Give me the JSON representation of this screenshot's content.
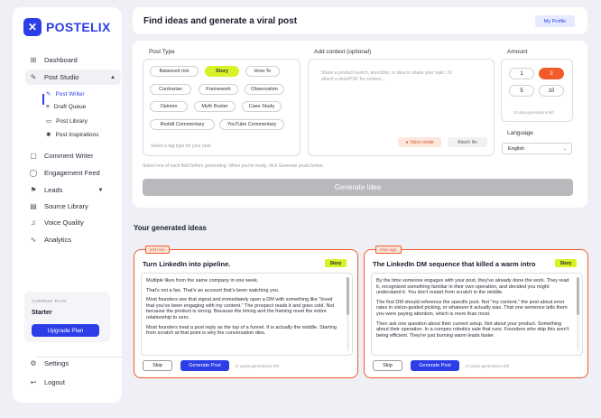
{
  "brand": {
    "name": "POSTELIX",
    "accent": "#2c3ee6",
    "highlight": "#d8f227",
    "orange": "#f15a29"
  },
  "sidebar": {
    "dashboard": "Dashboard",
    "post_studio": "Post Studio",
    "sub_items": [
      "Post Writer",
      "Draft Queue",
      "Post Library",
      "Post Inspirations"
    ],
    "comment_writer": "Comment Writer",
    "engagement_feed": "Engagement Feed",
    "leads": "Leads",
    "source_library": "Source Library",
    "voice_quality": "Voice Quality",
    "analytics": "Analytics",
    "plan_label": "CURRENT PLAN",
    "plan_name": "Starter",
    "upgrade": "Upgrade Plan",
    "settings": "Settings",
    "logout": "Logout"
  },
  "header": {
    "title": "Find ideas and generate a viral post",
    "profile": "My Profile"
  },
  "composer": {
    "post_type_title": "Post Type",
    "post_types": [
      "Balanced mix",
      "Story",
      "How-To",
      "Contrarian",
      "Framework",
      "Observation",
      "Opinion",
      "Myth Buster",
      "Case Study",
      "Reddit Commentary",
      "YouTube Commentary"
    ],
    "selected_type": "Story",
    "type_hint": "Select a tag type for your post.",
    "context_title": "Add context (optional)",
    "context_placeholder": "Share a product launch, anecdote, or idea to shape your topic. Or attach a deck/PDF for context...",
    "voice_mode": "Voice mode",
    "attach_file": "Attach file",
    "amount_title": "Amount",
    "amounts": [
      "1",
      "3",
      "5",
      "10"
    ],
    "selected_amount": "3",
    "amount_note": "14 idea generations left",
    "language_title": "Language",
    "language_value": "English",
    "fields_hint": "Select one of each field before generating. When you're ready, click Generate posts below.",
    "generate": "Generate Idea"
  },
  "ideas": {
    "title": "Your generated ideas",
    "cards": [
      {
        "time": "just now",
        "title": "Turn LinkedIn into pipeline.",
        "badge": "Story",
        "paragraphs": [
          "Multiple likes from the same company in one week.",
          "That's not a fan. That's an account that's been watching you.",
          "Most founders see that signal and immediately open a DM with something like \"loved that you've been engaging with my content.\" The prospect reads it and goes cold. Not because the product is wrong. Because the timing and the framing reset the entire relationship to zero.",
          "Most founders treat a post reply as the top of a funnel. It is actually the middle. Starting from scratch at that point is why the conversation dies."
        ],
        "skip": "Skip",
        "generate": "Generate Post",
        "left": "17 posts generations left"
      },
      {
        "time": "2min ago",
        "title": "The LinkedIn DM sequence that killed a warm intro",
        "badge": "Story",
        "paragraphs": [
          "By the time someone engages with your post, they've already done the work. They read it, recognized something familiar in their own operation, and decided you might understand it. You don't restart from scratch in the middle.",
          "The first DM should reference the specific post. Not \"my content,\" the post about error rates in vision-guided picking, or whatever it actually was. That one sentence tells them you were paying attention, which is more than most.",
          "Then ask one question about their current setup. Not about your product. Something about their operation. In a compex robotics sale that runs. Founders who skip this aren't being efficient. They're just burning warm leads faster."
        ],
        "skip": "Skip",
        "generate": "Generate Post",
        "left": "17 posts generations left"
      }
    ]
  }
}
